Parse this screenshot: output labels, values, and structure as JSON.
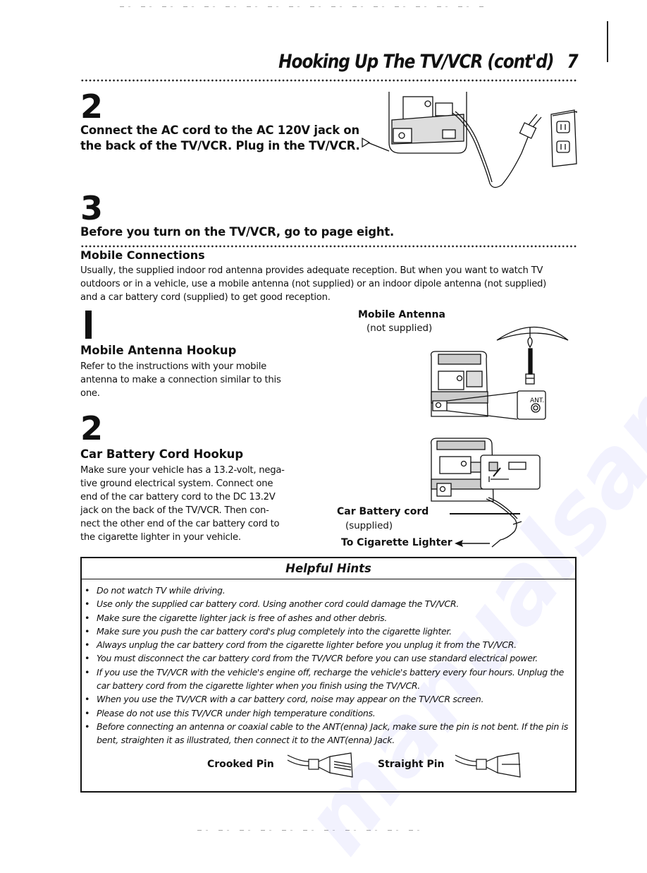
{
  "header": {
    "title": "Hooking Up The TV/VCR (cont'd)",
    "page_number": "7"
  },
  "step2": {
    "number": "2",
    "title_line1": "Connect the AC cord to the AC 120V jack on",
    "title_line2": "the back of the TV/VCR. Plug in the TV/VCR."
  },
  "step3": {
    "number": "3",
    "title": "Before you turn on the TV/VCR, go to page eight."
  },
  "mobile": {
    "heading": "Mobile Connections",
    "intro_line1": "Usually, the supplied indoor rod antenna provides adequate reception.  But when you want to watch TV",
    "intro_line2": "outdoors or in a vehicle, use a mobile antenna (not supplied) or an indoor dipole antenna (not supplied)",
    "intro_line3": "and a car battery cord (supplied) to get good reception.",
    "antenna_step": {
      "number": "1",
      "title": "Mobile Antenna Hookup",
      "text_line1": "Refer to the instructions with your mobile",
      "text_line2": "antenna to make a connection similar to this",
      "text_line3": "one."
    },
    "battery_step": {
      "number": "2",
      "title": "Car Battery Cord Hookup",
      "text_line1": "Make sure your vehicle has a 13.2-volt, nega-",
      "text_line2": "tive ground electrical system.  Connect one",
      "text_line3": "end of the car battery cord to the DC 13.2V",
      "text_line4": "jack on the back of the TV/VCR.  Then con-",
      "text_line5": "nect the other end of the car battery cord to",
      "text_line6": "the cigarette lighter in your vehicle."
    },
    "figure_antenna": {
      "label": "Mobile Antenna",
      "sublabel": "(not supplied)",
      "jack_label": "ANT."
    },
    "figure_battery": {
      "cord_label": "Car Battery cord",
      "cord_sublabel": "(supplied)",
      "lighter_label": "To Cigarette Lighter"
    }
  },
  "hints": {
    "heading": "Helpful Hints",
    "bullet": "•",
    "items": [
      "Do not watch TV while driving.",
      "Use only the supplied car battery cord.  Using another cord could damage the TV/VCR.",
      "Make sure the cigarette lighter jack is free of ashes and other debris.",
      "Make sure you push the car battery cord's plug completely into the cigarette lighter.",
      "Always unplug the car battery cord from the cigarette lighter before you unplug it from the TV/VCR.",
      "You must disconnect the car battery cord from the TV/VCR before you can use standard electrical power.",
      "If you use the TV/VCR with the vehicle's engine off, recharge the vehicle's battery every four hours.  Unplug the car battery cord from the cigarette lighter when you finish using the TV/VCR.",
      "When you use the TV/VCR with a car battery cord, noise may appear on the TV/VCR screen.",
      "Please do not use this TV/VCR under high temperature conditions.",
      "Before connecting an antenna or coaxial cable to the ANT(enna) Jack, make sure the pin is not bent. If the pin is bent, straighten it as illustrated, then connect it to the ANT(enna) Jack."
    ],
    "crooked_pin_label": "Crooked Pin",
    "straight_pin_label": "Straight Pin"
  }
}
